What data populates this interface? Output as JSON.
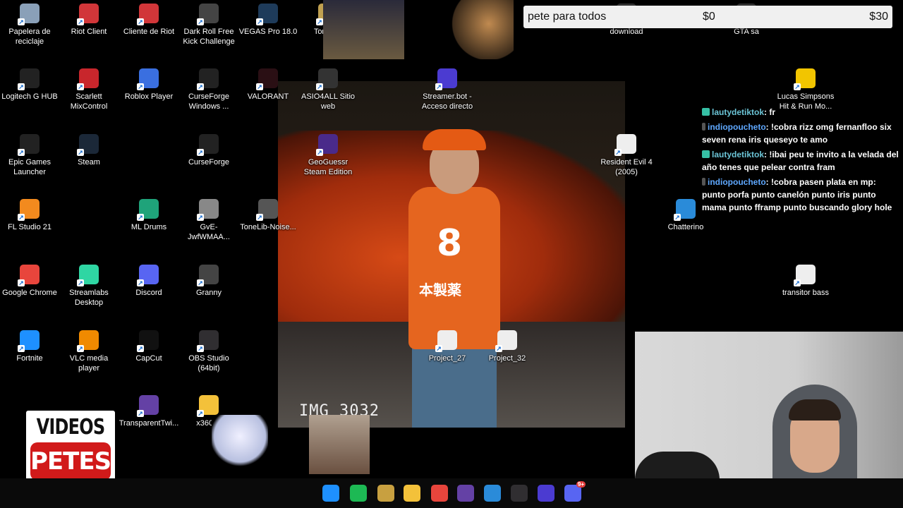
{
  "icons": [
    {
      "label": "Papelera de reciclaje",
      "icon": "recycle-bin-icon",
      "color": "#8aa0b8"
    },
    {
      "label": "Riot Client",
      "icon": "riot-icon",
      "color": "#d13639"
    },
    {
      "label": "Cliente de Riot",
      "icon": "riot-icon",
      "color": "#d13639"
    },
    {
      "label": "Dark Roll Free Kick Challenge",
      "icon": "ball-icon",
      "color": "#444"
    },
    {
      "label": "VEGAS Pro 18.0",
      "icon": "vegas-icon",
      "color": "#1e3b5a"
    },
    {
      "label": "Ton Rec",
      "icon": "app-icon",
      "color": "#c0a050"
    },
    {
      "label": "Logitech G HUB",
      "icon": "logitech-icon",
      "color": "#222"
    },
    {
      "label": "Scarlett MixControl",
      "icon": "scarlett-icon",
      "color": "#c8262c"
    },
    {
      "label": "Roblox Player",
      "icon": "roblox-icon",
      "color": "#3a6fe0"
    },
    {
      "label": "CurseForge Windows ...",
      "icon": "curseforge-icon",
      "color": "#222"
    },
    {
      "label": "VALORANT",
      "icon": "valorant-icon",
      "color": "#2a0f14"
    },
    {
      "label": "ASIO4ALL Sitio web",
      "icon": "asio-icon",
      "color": "#333"
    },
    {
      "label": "Streamer.bot - Acceso directo",
      "icon": "streamerbot-icon",
      "color": "#4b3bd1"
    },
    {
      "label": "Lucas Simpsons Hit & Run Mo...",
      "icon": "simpsons-icon",
      "color": "#f2c500"
    },
    {
      "label": "Epic Games Launcher",
      "icon": "epic-icon",
      "color": "#222"
    },
    {
      "label": "Steam",
      "icon": "steam-icon",
      "color": "#1b2838"
    },
    {
      "label": "CurseForge",
      "icon": "curseforge-icon",
      "color": "#222"
    },
    {
      "label": "GeoGuessr Steam Edition",
      "icon": "geoguessr-icon",
      "color": "#4a2a8a"
    },
    {
      "label": "Resident Evil 4 (2005)",
      "icon": "re4-icon",
      "color": "#eee"
    },
    {
      "label": "FL Studio 21",
      "icon": "flstudio-icon",
      "color": "#f28a1e"
    },
    {
      "label": "ML Drums",
      "icon": "mldrums-icon",
      "color": "#1fa37a"
    },
    {
      "label": "GvE-JwfWMAA...",
      "icon": "image-icon",
      "color": "#888"
    },
    {
      "label": "ToneLib-Noise...",
      "icon": "tonelib-icon",
      "color": "#555"
    },
    {
      "label": "Chatterino",
      "icon": "chatterino-icon",
      "color": "#2a8bd9"
    },
    {
      "label": "Google Chrome",
      "icon": "chrome-icon",
      "color": "#e8453c"
    },
    {
      "label": "Streamlabs Desktop",
      "icon": "streamlabs-icon",
      "color": "#2fd6a3"
    },
    {
      "label": "Discord",
      "icon": "discord-icon",
      "color": "#5865f2"
    },
    {
      "label": "Granny",
      "icon": "granny-icon",
      "color": "#444"
    },
    {
      "label": "transitor bass",
      "icon": "video-file-icon",
      "color": "#eee"
    },
    {
      "label": "Fortnite",
      "icon": "fortnite-icon",
      "color": "#1e90ff"
    },
    {
      "label": "VLC media player",
      "icon": "vlc-icon",
      "color": "#f08a00"
    },
    {
      "label": "CapCut",
      "icon": "capcut-icon",
      "color": "#111"
    },
    {
      "label": "OBS Studio (64bit)",
      "icon": "obs-icon",
      "color": "#302e31"
    },
    {
      "label": "Project_27",
      "icon": "video-file-icon",
      "color": "#eee"
    },
    {
      "label": "Project_32",
      "icon": "video-file-icon",
      "color": "#eee"
    },
    {
      "label": "TransparentTwi...",
      "icon": "twitch-icon",
      "color": "#6441a5"
    },
    {
      "label": "x360ce",
      "icon": "folder-icon",
      "color": "#f3c13a"
    },
    {
      "label": "download",
      "icon": "app-icon",
      "color": "#333"
    },
    {
      "label": "GTA sa",
      "icon": "app-icon",
      "color": "#333"
    }
  ],
  "pete_bar": {
    "title": "pete para todos",
    "start": "$0",
    "goal": "$30"
  },
  "photo": {
    "caption": "IMG_3032",
    "jersey_number": "8",
    "jersey_text": "本製薬"
  },
  "chat": [
    {
      "user": "lautydetiktok",
      "text": ": fr"
    },
    {
      "user": "indiopoucheto",
      "text": ": !cobra rizz omg fernanfloo six seven rena iris queseyo te amo"
    },
    {
      "user": "lautydetiktok",
      "text": ": !ibai peu te invito a la velada del año tenes que pelear contra fram"
    },
    {
      "user": "indiopoucheto",
      "text": ": !cobra pasen plata en mp: punto porfa punto canelón punto iris punto mama punto fframp punto buscando glory hole"
    }
  ],
  "videos_petes": {
    "line1": "VIDEOS",
    "line2": "PETES"
  },
  "taskbar": [
    "windows-start-icon",
    "spotify-icon",
    "app-icon",
    "file-explorer-icon",
    "chrome-icon",
    "twitch-icon",
    "chatterino-icon",
    "obs-icon",
    "streamerbot-icon",
    "discord-icon"
  ],
  "discord_badge": "9+"
}
